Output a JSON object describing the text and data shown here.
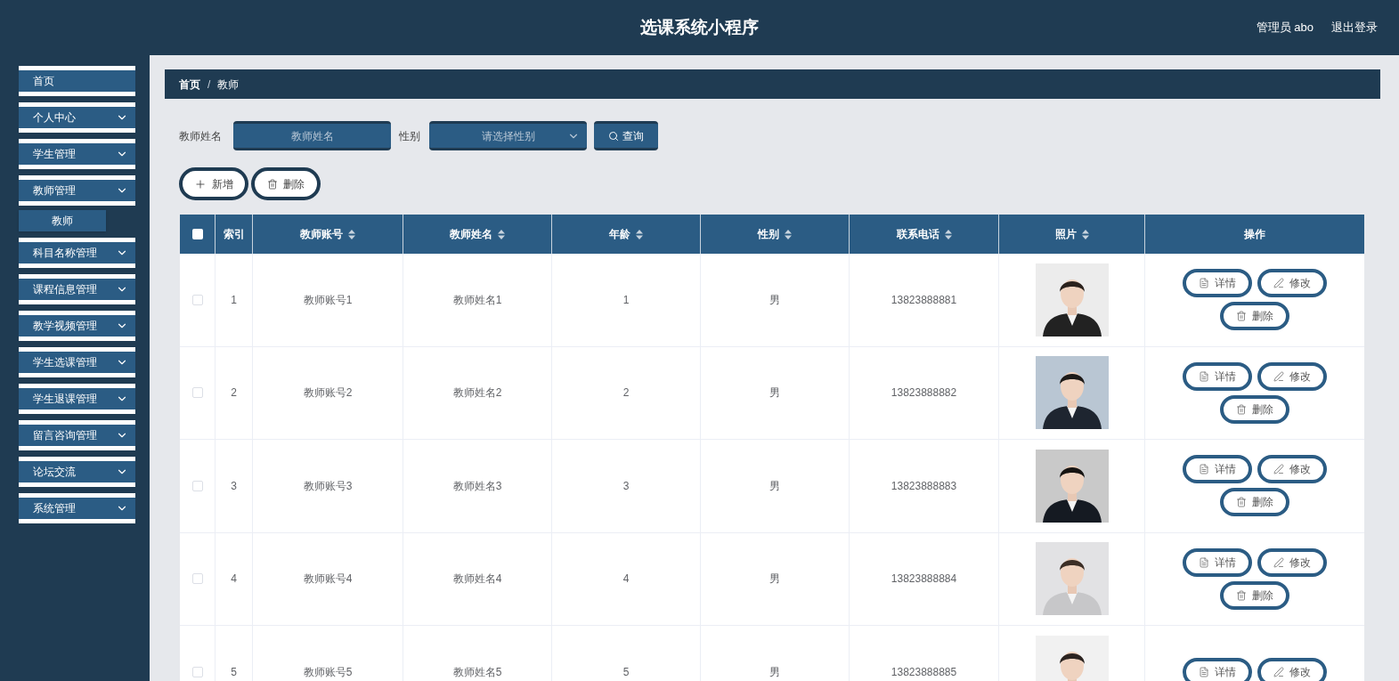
{
  "header": {
    "title": "选课系统小程序",
    "user": "管理员 abo",
    "logout": "退出登录"
  },
  "sidebar": {
    "items": [
      {
        "label": "首页",
        "kind": "link"
      },
      {
        "label": "个人中心",
        "kind": "menu"
      },
      {
        "label": "学生管理",
        "kind": "menu"
      },
      {
        "label": "教师管理",
        "kind": "menu",
        "children": [
          {
            "label": "教师"
          }
        ]
      },
      {
        "label": "科目名称管理",
        "kind": "menu"
      },
      {
        "label": "课程信息管理",
        "kind": "menu"
      },
      {
        "label": "教学视频管理",
        "kind": "menu"
      },
      {
        "label": "学生选课管理",
        "kind": "menu"
      },
      {
        "label": "学生退课管理",
        "kind": "menu"
      },
      {
        "label": "留言咨询管理",
        "kind": "menu"
      },
      {
        "label": "论坛交流",
        "kind": "menu"
      },
      {
        "label": "系统管理",
        "kind": "menu"
      }
    ]
  },
  "breadcrumb": {
    "separator": "/",
    "items": [
      "首页",
      "教师"
    ]
  },
  "search": {
    "name_label": "教师姓名",
    "name_placeholder": "教师姓名",
    "gender_label": "性别",
    "gender_placeholder": "请选择性别",
    "query_button": "查询"
  },
  "toolbar": [
    "新增",
    "删除"
  ],
  "table": {
    "select_all_checked": false,
    "columns": [
      {
        "label": "索引",
        "sortable": false
      },
      {
        "label": "教师账号",
        "sortable": true
      },
      {
        "label": "教师姓名",
        "sortable": true
      },
      {
        "label": "年龄",
        "sortable": true
      },
      {
        "label": "性别",
        "sortable": true
      },
      {
        "label": "联系电话",
        "sortable": true
      },
      {
        "label": "照片",
        "sortable": true
      },
      {
        "label": "操作",
        "sortable": false
      }
    ],
    "rows": [
      {
        "checked": false,
        "index": "1",
        "account": "教师账号1",
        "name": "教师姓名1",
        "age": "1",
        "gender": "男",
        "phone": "13823888881",
        "photo": {
          "kind": "picture"
        },
        "actions": [
          "详情",
          "修改",
          "删除"
        ]
      },
      {
        "checked": false,
        "index": "2",
        "account": "教师账号2",
        "name": "教师姓名2",
        "age": "2",
        "gender": "男",
        "phone": "13823888882",
        "photo": {
          "kind": "picture"
        },
        "actions": [
          "详情",
          "修改",
          "删除"
        ]
      },
      {
        "checked": false,
        "index": "3",
        "account": "教师账号3",
        "name": "教师姓名3",
        "age": "3",
        "gender": "男",
        "phone": "13823888883",
        "photo": {
          "kind": "picture"
        },
        "actions": [
          "详情",
          "修改",
          "删除"
        ]
      },
      {
        "checked": false,
        "index": "4",
        "account": "教师账号4",
        "name": "教师姓名4",
        "age": "4",
        "gender": "男",
        "phone": "13823888884",
        "photo": {
          "kind": "picture"
        },
        "actions": [
          "详情",
          "修改",
          "删除"
        ]
      },
      {
        "checked": false,
        "index": "5",
        "account": "教师账号5",
        "name": "教师姓名5",
        "age": "5",
        "gender": "男",
        "phone": "13823888885",
        "photo": {
          "kind": "picture"
        },
        "actions": [
          "详情",
          "修改"
        ]
      }
    ]
  }
}
